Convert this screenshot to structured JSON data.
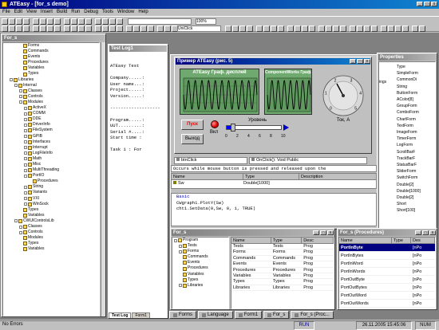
{
  "app": {
    "title": "ATEasy - [for_s demo]"
  },
  "menu": [
    "File",
    "Edit",
    "View",
    "Insert",
    "Build",
    "Run",
    "Debug",
    "Tools",
    "Window",
    "Help"
  ],
  "toolbar": {
    "combo_value": "",
    "zoom": "100%",
    "uniclick": "UniClick"
  },
  "left": {
    "title": "For_s",
    "tree": [
      {
        "t": "Forms",
        "d": 3,
        "x": ""
      },
      {
        "t": "Commands",
        "d": 3,
        "x": ""
      },
      {
        "t": "Events",
        "d": 3,
        "x": ""
      },
      {
        "t": "Procedures",
        "d": 3,
        "x": ""
      },
      {
        "t": "Variables",
        "d": 3,
        "x": ""
      },
      {
        "t": "Types",
        "d": 3,
        "x": ""
      },
      {
        "t": "Libraries",
        "d": 1,
        "x": "-"
      },
      {
        "t": "Internal",
        "d": 2,
        "x": "-"
      },
      {
        "t": "Classes",
        "d": 3,
        "x": "+"
      },
      {
        "t": "Controls",
        "d": 3,
        "x": "+"
      },
      {
        "t": "Modules",
        "d": 3,
        "x": "-"
      },
      {
        "t": "ActiveX",
        "d": 4,
        "x": "+"
      },
      {
        "t": "COMM",
        "d": 4,
        "x": "+"
      },
      {
        "t": "DDE",
        "d": 4,
        "x": "+"
      },
      {
        "t": "DriverInfo",
        "d": 4,
        "x": "+"
      },
      {
        "t": "FileSystem",
        "d": 4,
        "x": "+"
      },
      {
        "t": "GPIB",
        "d": 4,
        "x": "+"
      },
      {
        "t": "Interfaces",
        "d": 4,
        "x": "+"
      },
      {
        "t": "Interrupt",
        "d": 4,
        "x": "+"
      },
      {
        "t": "LogFileInfo",
        "d": 4,
        "x": "+"
      },
      {
        "t": "Math",
        "d": 4,
        "x": "+"
      },
      {
        "t": "Misc",
        "d": 4,
        "x": "+"
      },
      {
        "t": "MultiThreading",
        "d": 4,
        "x": "+"
      },
      {
        "t": "PortIO",
        "d": 4,
        "x": "-"
      },
      {
        "t": "Procedures",
        "d": 5,
        "x": ""
      },
      {
        "t": "String",
        "d": 4,
        "x": "+"
      },
      {
        "t": "Variants",
        "d": 4,
        "x": "+"
      },
      {
        "t": "VXI",
        "d": 4,
        "x": "+"
      },
      {
        "t": "WinSock",
        "d": 4,
        "x": "+"
      },
      {
        "t": "Types",
        "d": 3,
        "x": ""
      },
      {
        "t": "Variables",
        "d": 3,
        "x": ""
      },
      {
        "t": "CWUIControlsLib",
        "d": 2,
        "x": "-"
      },
      {
        "t": "Classes",
        "d": 3,
        "x": "+"
      },
      {
        "t": "Controls",
        "d": 3,
        "x": "+"
      },
      {
        "t": "Modules",
        "d": 3,
        "x": ""
      },
      {
        "t": "Types",
        "d": 3,
        "x": ""
      },
      {
        "t": "Variables",
        "d": 3,
        "x": ""
      }
    ]
  },
  "testlog": {
    "title": "Test Log1",
    "lines": [
      "ATEasy Test",
      "",
      "Company.....:",
      "User name...:",
      "Project.....:",
      "Version.....:",
      "",
      "-------------------",
      "",
      "Program.....:",
      "UUT.........:",
      "Serial #....:",
      "Start time :",
      "",
      "Task 1 : For"
    ],
    "tabs": [
      "Test Log",
      "Form1"
    ]
  },
  "dialog": {
    "title": "Пример ATEasy (рис. 5)",
    "graph1_title": "ATEasy Граф. дисплей",
    "graph2_title": "ComponentWorks Граф.",
    "start_btn": "Пуск",
    "exit_btn": "Выход",
    "led_label": "Вкл",
    "slider_label": "Уровень",
    "slider_ticks": [
      "0",
      "2",
      "4",
      "6",
      "8",
      "10"
    ],
    "knob_label": "Ток, А",
    "knob_ticks": [
      "0",
      "1",
      "2",
      "3",
      "4",
      "5"
    ]
  },
  "code": {
    "object": "btnClick",
    "proc": "OnClick(): Void Public",
    "description": "Occurs while mouse button is pressed and released upon the",
    "table_headers": [
      "Name",
      "Type",
      "Description"
    ],
    "table_row": {
      "name": "Sw",
      "type": "Double[1000]",
      "desc": ""
    },
    "lines": [
      "Basic",
      "CWgraph1.PlotY(Sw)",
      "cht1.SetData(0,Sw, 0, 1, TRUE)"
    ]
  },
  "props": {
    "title": "Properties",
    "left_list": [
      "Type",
      "SimpleForm",
      "CommonDi",
      "String",
      "ButtonForm",
      "AColor[8]",
      "GroupForm",
      "ComboForm",
      "ChartForm",
      "TextForm",
      "ImageForm",
      "TimerForm",
      "LogForm",
      "ScrollBarF",
      "TrackBarF",
      "StatusBarF",
      "SliderForm",
      "SwitchForm",
      "Double[2]",
      "Double[1000]",
      "Double[2]",
      "Short",
      "Short[100]"
    ],
    "mid_frag": "ings"
  },
  "program": {
    "title": "For_s",
    "tree": [
      {
        "t": "Program",
        "d": 0,
        "x": "-"
      },
      {
        "t": "Tests",
        "d": 1,
        "x": "+"
      },
      {
        "t": "Forms",
        "d": 1,
        "x": "+"
      },
      {
        "t": "Commands",
        "d": 1,
        "x": ""
      },
      {
        "t": "Events",
        "d": 1,
        "x": ""
      },
      {
        "t": "Procedures",
        "d": 1,
        "x": ""
      },
      {
        "t": "Variables",
        "d": 1,
        "x": ""
      },
      {
        "t": "Types",
        "d": 1,
        "x": ""
      },
      {
        "t": "Libraries",
        "d": 1,
        "x": "+"
      }
    ],
    "list_headers": [
      "Name",
      "Type",
      "Desc"
    ],
    "list": [
      [
        "Tests",
        "Tests",
        "Prog"
      ],
      [
        "Forms",
        "Forms",
        "Prog"
      ],
      [
        "Commands",
        "Commands",
        "Prog"
      ],
      [
        "Events",
        "Events",
        "Prog"
      ],
      [
        "Procedures",
        "Procedures",
        "Prog"
      ],
      [
        "Variables",
        "Variables",
        "Prog"
      ],
      [
        "Types",
        "Types",
        "Prog"
      ],
      [
        "Libraries",
        "Libraries",
        "Prog"
      ]
    ]
  },
  "procs": {
    "title": "For_s (Procedures)",
    "headers": [
      "Name",
      "Type",
      "Des"
    ],
    "rows": [
      [
        "PortInByte",
        "",
        "[nPo"
      ],
      [
        "PortInBytes",
        "",
        "[nPo"
      ],
      [
        "PortInWord",
        "",
        "[nPo"
      ],
      [
        "PortInWords",
        "",
        "[nPo"
      ],
      [
        "PortOutByte",
        "",
        "[nPo"
      ],
      [
        "PortOutBytes",
        "",
        "[nPo"
      ],
      [
        "PortOutWord",
        "",
        "[nPo"
      ],
      [
        "PortOutWords",
        "",
        "[nPo"
      ]
    ],
    "public": "Public"
  },
  "bottom_tabs": [
    "Forms",
    "Language",
    "Form1",
    "For_s",
    "For_s (Proc..."
  ],
  "status": {
    "left": "No Errors",
    "run": "RUN",
    "pos": "26.11.2005 15:45:06",
    "num": "NUM"
  },
  "colors": {
    "title": "#000080",
    "desktop": "#808080",
    "graph_bg": "#6fa96f",
    "wave": "#000000",
    "start": "#ff0000",
    "led": "#ff0000",
    "gauge": "#0000ff",
    "select": "#000080"
  }
}
